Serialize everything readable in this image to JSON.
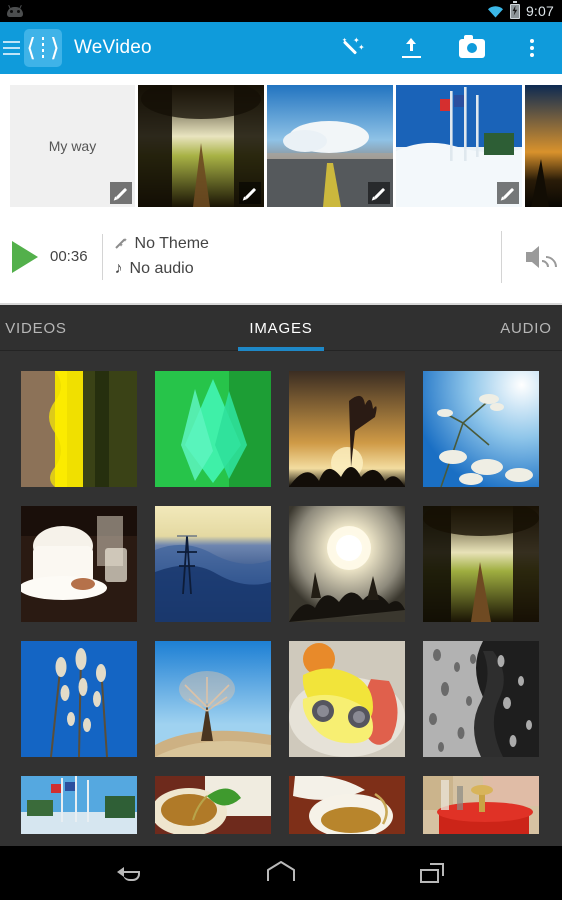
{
  "statusbar": {
    "notification_icon": "android-robot-icon",
    "wifi_icon": "wifi-icon",
    "battery_icon": "battery-charging-icon",
    "time": "9:07"
  },
  "actionbar": {
    "menu_icon": "hamburger-menu-icon",
    "logo_icon": "wevideo-logo-icon",
    "title": "WeVideo",
    "actions": [
      {
        "name": "magic-wand-button",
        "icon": "magic-wand-icon",
        "label": "Auto edit"
      },
      {
        "name": "upload-button",
        "icon": "upload-icon",
        "label": "Upload"
      },
      {
        "name": "camera-button",
        "icon": "camera-icon",
        "label": "Camera"
      },
      {
        "name": "overflow-menu-button",
        "icon": "kebab-menu-icon",
        "label": "More options"
      }
    ]
  },
  "storyboard": {
    "title_card": {
      "text": "My way",
      "edit_icon": "pencil-icon"
    },
    "clips": [
      {
        "name": "clip-forest-path",
        "edit_icon": "pencil-icon",
        "c1": "#1d1708",
        "c2": "#9ba63a",
        "c3": "#5e4420",
        "c4": "#0d0c06"
      },
      {
        "name": "clip-road-clouds",
        "edit_icon": "pencil-icon",
        "c1": "#2e7fc4",
        "c2": "#e8eef2",
        "c3": "#6f7475",
        "c4": "#2b2f30"
      },
      {
        "name": "clip-snow-poles",
        "edit_icon": "pencil-icon",
        "c1": "#1a63b8",
        "c2": "#2f6a3a",
        "c3": "#e6eef3",
        "c4": "#c7d6de"
      },
      {
        "name": "clip-sunset-grass",
        "edit_icon": "pencil-icon",
        "c1": "#12305c",
        "c2": "#c98a2a",
        "c3": "#1a1206",
        "c4": "#0a0804"
      }
    ]
  },
  "playbar": {
    "play_icon": "play-icon",
    "duration": "00:36",
    "theme_icon": "magic-wand-icon",
    "theme": "No Theme",
    "audio_icon": "music-note-icon",
    "audio": "No audio",
    "volume_icon": "speaker-icon"
  },
  "tabs": [
    {
      "name": "tab-videos",
      "label": "VIDEOS",
      "active": false
    },
    {
      "name": "tab-images",
      "label": "IMAGES",
      "active": true
    },
    {
      "name": "tab-audio",
      "label": "AUDIO",
      "active": false
    }
  ],
  "accent_color": "#1e88c7",
  "gallery": {
    "rows": [
      [
        {
          "name": "thumb-yellow-moss-bark",
          "c1": "#6b5a4a",
          "c2": "#f2e400",
          "c3": "#2d3510",
          "c4": "#0e1206"
        },
        {
          "name": "thumb-green-leaf-dew",
          "c1": "#1bd98f",
          "c2": "#3ff2a0",
          "c3": "#2bb54a",
          "c4": "#0f7a2b"
        },
        {
          "name": "thumb-sunset-silhouette-flowers",
          "c1": "#2a2018",
          "c2": "#d9a34a",
          "c3": "#f0d08a",
          "c4": "#120d08"
        },
        {
          "name": "thumb-blossom-blue-sky",
          "c1": "#2f86d8",
          "c2": "#bfe0f5",
          "c3": "#e8f2fa",
          "c4": "#1d6ab5"
        }
      ],
      [
        {
          "name": "thumb-coffee-cup-cafe",
          "c1": "#2a1a14",
          "c2": "#f4efe6",
          "c3": "#d9cfc2",
          "c4": "#1a1008"
        },
        {
          "name": "thumb-pylon-fog-valley",
          "c1": "#efe6b8",
          "c2": "#2a4f8c",
          "c3": "#122a52",
          "c4": "#091428"
        },
        {
          "name": "thumb-sun-haze-trees",
          "c1": "#b8b0a0",
          "c2": "#fdf6d8",
          "c3": "#5a5248",
          "c4": "#1a1712"
        },
        {
          "name": "thumb-forest-path-trees",
          "c1": "#1a1406",
          "c2": "#9aa83c",
          "c3": "#6a4a22",
          "c4": "#0c0a04"
        }
      ],
      [
        {
          "name": "thumb-pussy-willow-blue",
          "c1": "#1668c8",
          "c2": "#2a7fd8",
          "c3": "#dcd6c8",
          "c4": "#0f4f9e"
        },
        {
          "name": "thumb-lone-tree-hill",
          "c1": "#2f8ddb",
          "c2": "#c6a97e",
          "c3": "#d8c49a",
          "c4": "#8fc4e8"
        },
        {
          "name": "thumb-bananas-plate",
          "c1": "#efe24a",
          "c2": "#f6ef8e",
          "c3": "#e8a23a",
          "c4": "#d9d4c8"
        },
        {
          "name": "thumb-rain-drops-window",
          "c1": "#9a9a9a",
          "c2": "#c8c8c8",
          "c3": "#2a2a2a",
          "c4": "#4a4a4a"
        }
      ],
      [
        {
          "name": "thumb-flag-poles-snow",
          "c1": "#4aa0e0",
          "c2": "#9fd0ef",
          "c3": "#3a6b3a",
          "c4": "#d8e6ef"
        },
        {
          "name": "thumb-tea-cup-leaf",
          "c1": "#6b2a20",
          "c2": "#efe8d8",
          "c3": "#c8a050",
          "c4": "#3a1a10"
        },
        {
          "name": "thumb-tea-cup-napkin",
          "c1": "#7a2a18",
          "c2": "#f4f0e6",
          "c3": "#c8a858",
          "c4": "#4a1a0e"
        },
        {
          "name": "thumb-red-table-setting",
          "c1": "#d8c8a8",
          "c2": "#c82a18",
          "c3": "#8a4a20",
          "c4": "#e8d8b8"
        }
      ]
    ]
  },
  "navbar": {
    "buttons": [
      {
        "name": "nav-back-button",
        "icon": "back-arrow-icon"
      },
      {
        "name": "nav-home-button",
        "icon": "home-icon"
      },
      {
        "name": "nav-recents-button",
        "icon": "recent-apps-icon"
      }
    ]
  }
}
